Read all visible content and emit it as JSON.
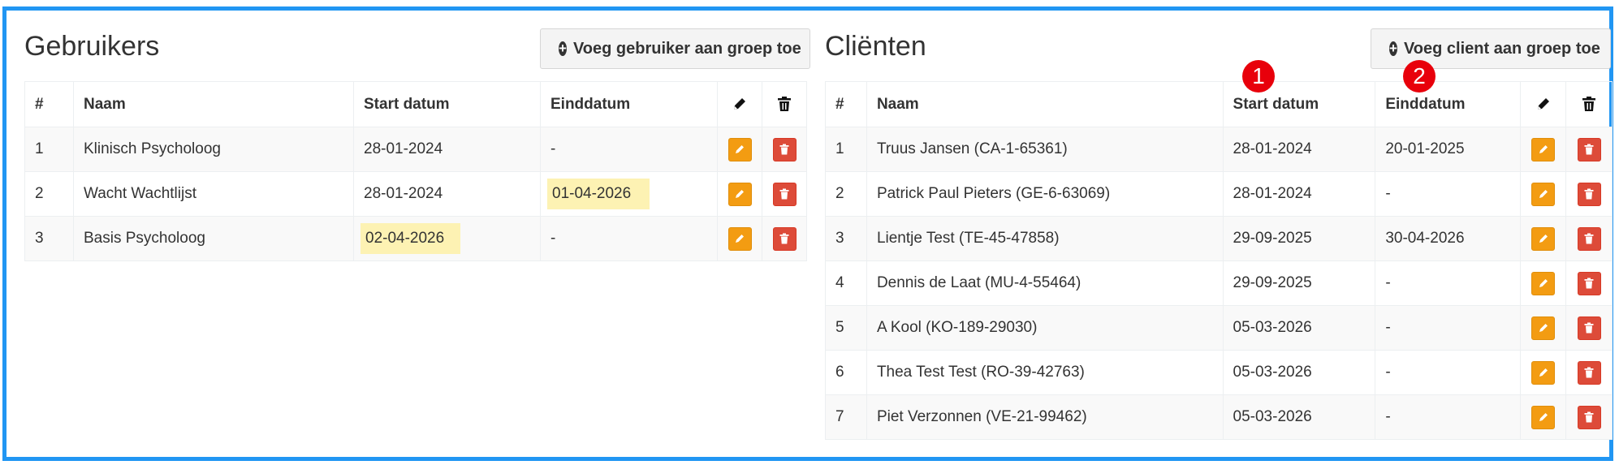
{
  "users": {
    "title": "Gebruikers",
    "add_label": "Voeg gebruiker aan groep toe",
    "columns": [
      "#",
      "Naam",
      "Start datum",
      "Einddatum"
    ],
    "rows": [
      {
        "nr": "1",
        "name": "Klinisch Psycholoog",
        "start": "28-01-2024",
        "end": "-"
      },
      {
        "nr": "2",
        "name": "Wacht Wachtlijst",
        "start": "28-01-2024",
        "end": "01-04-2026"
      },
      {
        "nr": "3",
        "name": "Basis Psycholoog",
        "start": "02-04-2026",
        "end": "-"
      }
    ]
  },
  "clients": {
    "title": "Cliënten",
    "add_label": "Voeg client aan groep toe",
    "columns": [
      "#",
      "Naam",
      "Start datum",
      "Einddatum"
    ],
    "rows": [
      {
        "nr": "1",
        "name": "Truus Jansen (CA-1-65361)",
        "start": "28-01-2024",
        "end": "20-01-2025"
      },
      {
        "nr": "2",
        "name": "Patrick Paul Pieters (GE-6-63069)",
        "start": "28-01-2024",
        "end": "-"
      },
      {
        "nr": "3",
        "name": "Lientje Test (TE-45-47858)",
        "start": "29-09-2025",
        "end": "30-04-2026"
      },
      {
        "nr": "4",
        "name": "Dennis de Laat (MU-4-55464)",
        "start": "29-09-2025",
        "end": "-"
      },
      {
        "nr": "5",
        "name": "A Kool (KO-189-29030)",
        "start": "05-03-2026",
        "end": "-"
      },
      {
        "nr": "6",
        "name": "Thea Test Test (RO-39-42763)",
        "start": "05-03-2026",
        "end": "-"
      },
      {
        "nr": "7",
        "name": "Piet Verzonnen (VE-21-99462)",
        "start": "05-03-2026",
        "end": "-"
      }
    ]
  },
  "annotations": [
    "1",
    "2"
  ],
  "icons": {
    "add": "plus-circle-icon",
    "edit": "pencil-icon",
    "delete": "trash-icon"
  },
  "colors": {
    "frame": "#2196f3",
    "edit": "#f39c12",
    "delete": "#dd4b39",
    "highlight": "#fdf2b3",
    "badge": "#e8000b"
  }
}
